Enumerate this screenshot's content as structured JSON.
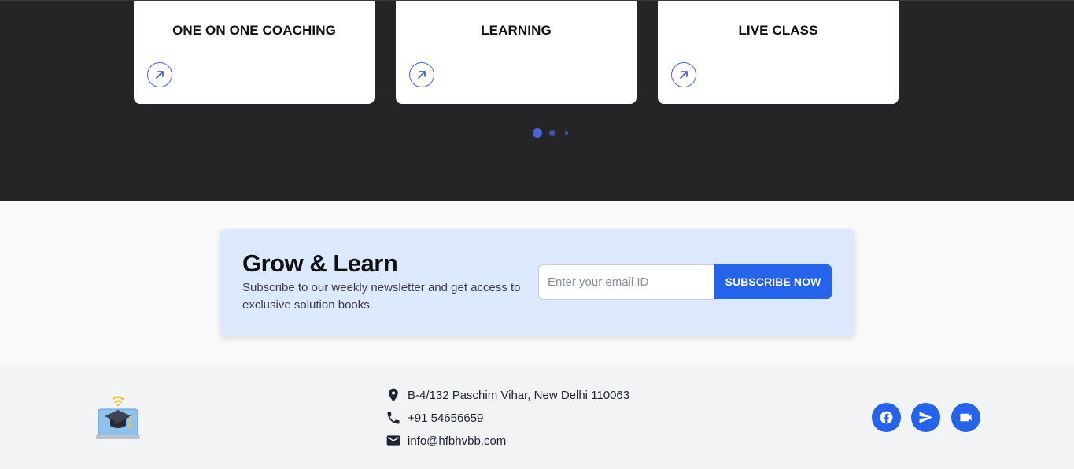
{
  "cards": [
    {
      "title": "ONE ON ONE COACHING",
      "icon": "arrow-up-right-icon"
    },
    {
      "title": "LEARNING",
      "icon": "arrow-up-right-icon"
    },
    {
      "title": "LIVE CLASS",
      "icon": "arrow-up-right-icon"
    }
  ],
  "carousel": {
    "pages": 3,
    "active_page": 1
  },
  "newsletter": {
    "title": "Grow & Learn",
    "description": "Subscribe to our weekly newsletter and get access to exclusive solution books.",
    "email_placeholder": "Enter your email ID",
    "email_value": "",
    "button_label": "SUBSCRIBE NOW"
  },
  "footer": {
    "logo_icon": "graduation-cap-laptop-icon",
    "address": "B-4/132 Paschim Vihar, New Delhi 110063",
    "phone": "+91 54656659",
    "email": "info@hfbhvbb.com",
    "social": [
      {
        "name": "facebook",
        "icon": "facebook-icon"
      },
      {
        "name": "telegram",
        "icon": "send-icon"
      },
      {
        "name": "video",
        "icon": "video-camera-icon"
      }
    ]
  },
  "colors": {
    "accent": "#2563eb",
    "dark_background": "#252527",
    "newsletter_background": "#dce8fb",
    "footer_background": "#f2f3f5"
  }
}
